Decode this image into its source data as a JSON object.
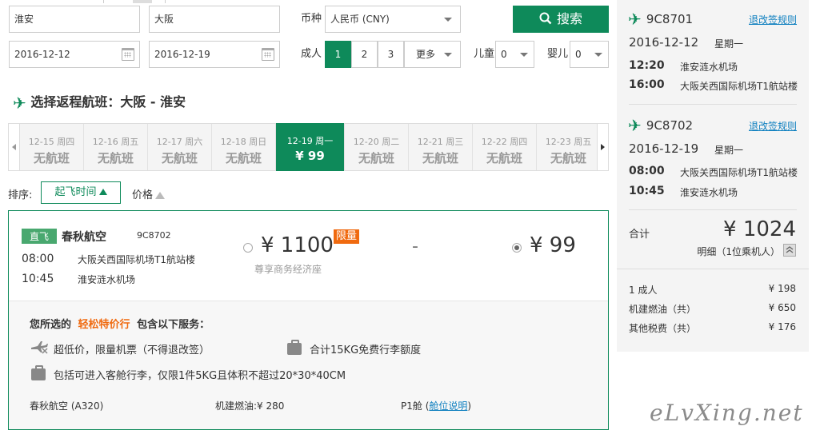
{
  "search": {
    "from": "淮安",
    "to": "大阪",
    "depart_date": "2016-12-12",
    "return_date": "2016-12-19",
    "currency_label": "币种",
    "currency_value": "人民币 (CNY)",
    "search_label": "搜索",
    "adult_label": "成人",
    "adult_options": [
      "1",
      "2",
      "3"
    ],
    "more_label": "更多",
    "child_label": "儿童",
    "child_value": "0",
    "infant_label": "婴儿",
    "infant_value": "0"
  },
  "section_title": "选择返程航班：大阪 - 淮安",
  "dates": [
    {
      "date": "12-15 周四",
      "price": "无航班",
      "active": false
    },
    {
      "date": "12-16 周五",
      "price": "无航班",
      "active": false
    },
    {
      "date": "12-17 周六",
      "price": "无航班",
      "active": false
    },
    {
      "date": "12-18 周日",
      "price": "无航班",
      "active": false
    },
    {
      "date": "12-19 周一",
      "price": "¥ 99",
      "active": true
    },
    {
      "date": "12-20 周二",
      "price": "无航班",
      "active": false
    },
    {
      "date": "12-21 周三",
      "price": "无航班",
      "active": false
    },
    {
      "date": "12-22 周四",
      "price": "无航班",
      "active": false
    },
    {
      "date": "12-23 周五",
      "price": "无航班",
      "active": false
    }
  ],
  "sort": {
    "label": "排序:",
    "departure": "起飞时间",
    "price": "价格"
  },
  "flight": {
    "direct": "直飞",
    "airline": "春秋航空",
    "number": "9C8702",
    "dep_time": "08:00",
    "dep_airport": "大阪关西国际机场T1航站楼",
    "arr_time": "10:45",
    "arr_airport": "淮安涟水机场",
    "business_price": "¥ 1100",
    "limit_tag": "限量",
    "business_class": "尊享商务经济座",
    "dash": "-",
    "economy_price": "¥ 99",
    "services_prefix": "您所选的",
    "services_fare": "轻松特价行",
    "services_suffix": "包含以下服务：",
    "service_1": "超低价，限量机票（不得退改签）",
    "service_2": "合计15KG免费行李额度",
    "service_3": "包括可进入客舱行李，仅限1件5KG且体积不超过20*30*40CM",
    "aircraft": "春秋航空 (A320)",
    "fuel": "机建燃油:¥ 280",
    "cabin": "P1舱",
    "cabin_link": "舱位说明"
  },
  "summary": {
    "outbound": {
      "number": "9C8701",
      "rule_link": "退改签规则",
      "date": "2016-12-12",
      "weekday": "星期一",
      "dep_time": "12:20",
      "dep_airport": "淮安涟水机场",
      "arr_time": "16:00",
      "arr_airport": "大阪关西国际机场T1航站楼"
    },
    "return": {
      "number": "9C8702",
      "rule_link": "退改签规则",
      "date": "2016-12-19",
      "weekday": "星期一",
      "dep_time": "08:00",
      "dep_airport": "大阪关西国际机场T1航站楼",
      "arr_time": "10:45",
      "arr_airport": "淮安涟水机场"
    },
    "total_label": "合计",
    "total_value": "¥ 1024",
    "detail_label": "明细（1位乘机人）",
    "rows": [
      {
        "label": "1 成人",
        "value": "¥ 198"
      },
      {
        "label": "机建燃油（共）",
        "value": "¥ 650"
      },
      {
        "label": "其他税费（共）",
        "value": "¥ 176"
      }
    ]
  },
  "watermark": "eLvXing.net",
  "colors": {
    "accent": "#0e8a5a",
    "orange": "#f06a0f",
    "link": "#0e7fbf"
  }
}
